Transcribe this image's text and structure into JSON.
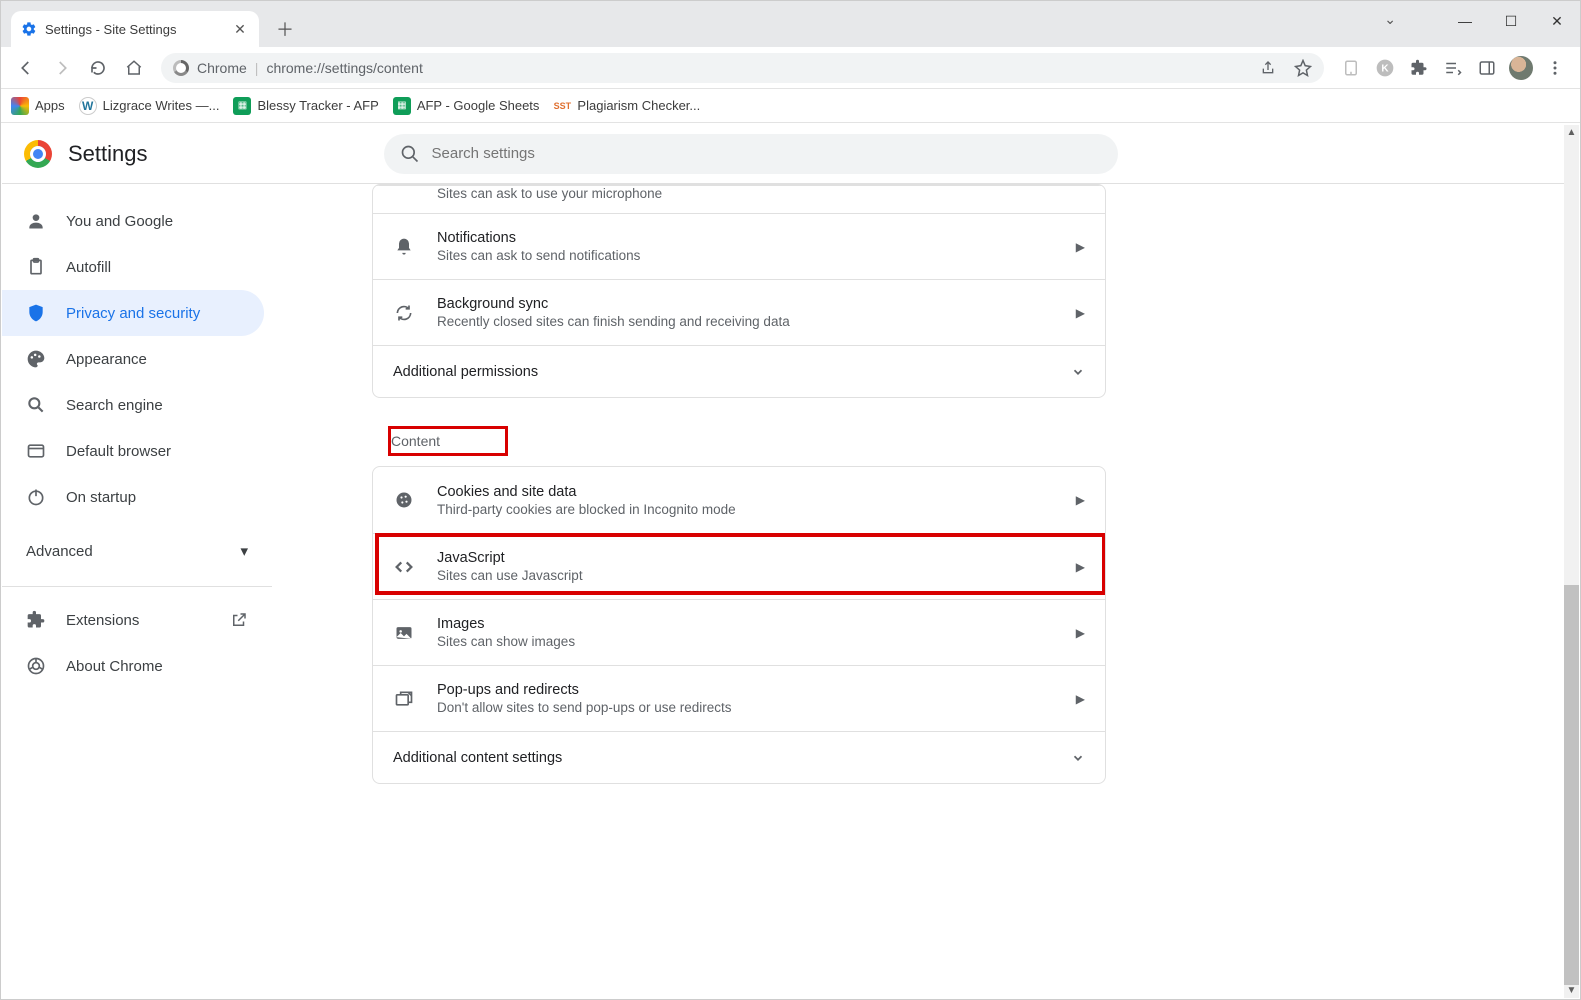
{
  "browser": {
    "tab_title": "Settings - Site Settings",
    "address_label": "Chrome",
    "address_url": "chrome://settings/content"
  },
  "bookmarks": {
    "apps": "Apps",
    "b1": "Lizgrace Writes —...",
    "b2": "Blessy Tracker - AFP",
    "b3": "AFP - Google Sheets",
    "b4": "Plagiarism Checker..."
  },
  "header": {
    "title": "Settings",
    "search_placeholder": "Search settings"
  },
  "nav": {
    "you": "You and Google",
    "autofill": "Autofill",
    "privacy": "Privacy and security",
    "appearance": "Appearance",
    "search": "Search engine",
    "default": "Default browser",
    "startup": "On startup",
    "advanced": "Advanced",
    "extensions": "Extensions",
    "about": "About Chrome"
  },
  "rows": {
    "partial_desc": "Sites can ask to use your microphone",
    "notif_t": "Notifications",
    "notif_d": "Sites can ask to send notifications",
    "bg_t": "Background sync",
    "bg_d": "Recently closed sites can finish sending and receiving data",
    "addperm": "Additional permissions",
    "content_label": "Content",
    "cookies_t": "Cookies and site data",
    "cookies_d": "Third-party cookies are blocked in Incognito mode",
    "js_t": "JavaScript",
    "js_d": "Sites can use Javascript",
    "img_t": "Images",
    "img_d": "Sites can show images",
    "pop_t": "Pop-ups and redirects",
    "pop_d": "Don't allow sites to send pop-ups or use redirects",
    "addcontent": "Additional content settings"
  }
}
